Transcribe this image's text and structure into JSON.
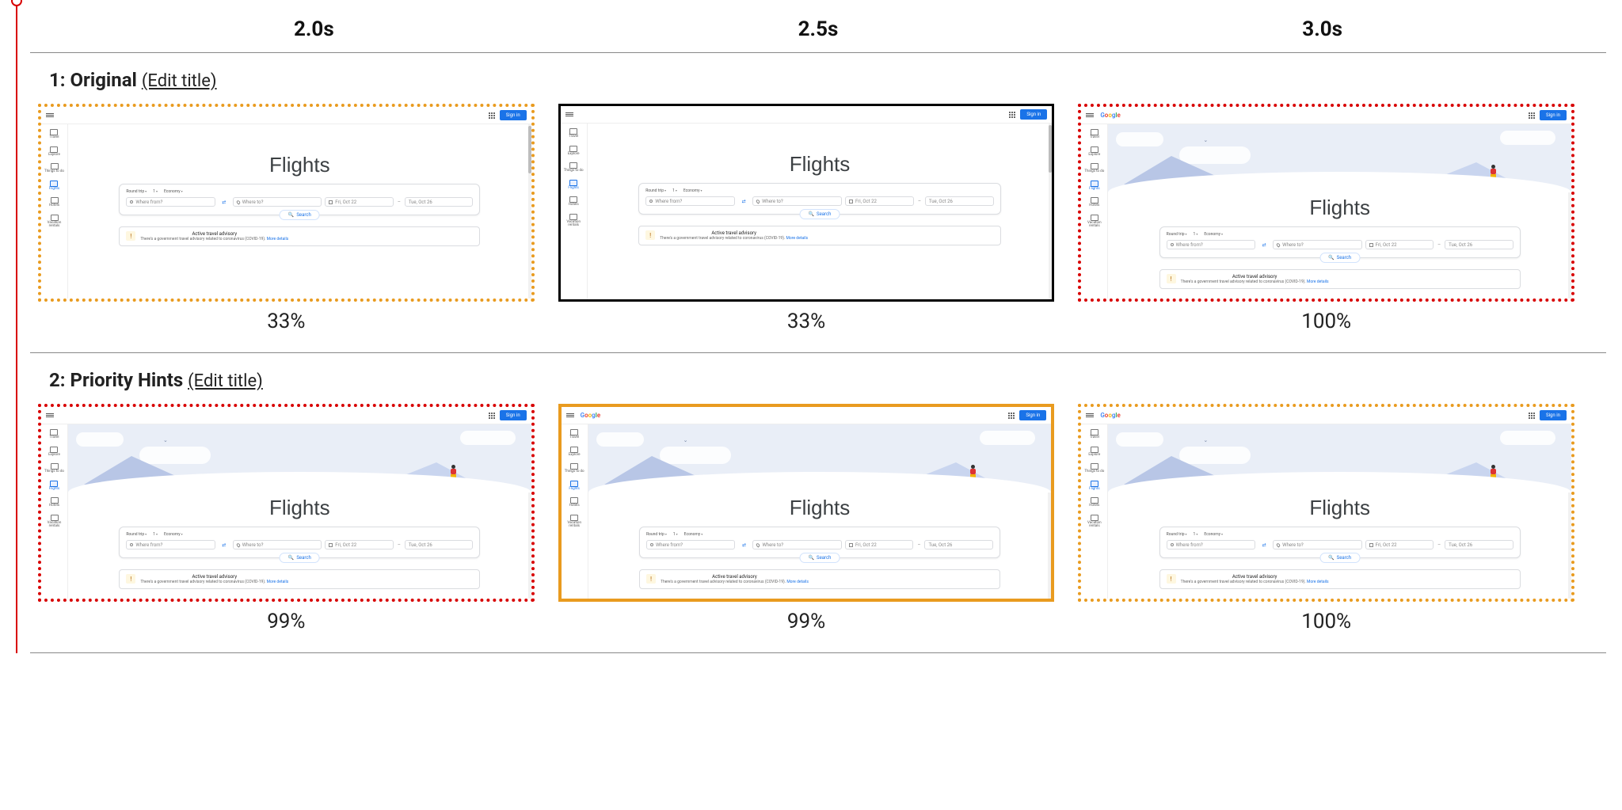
{
  "timeline": {
    "times": [
      "2.0s",
      "2.5s",
      "3.0s"
    ]
  },
  "edit_title_text": "(Edit title)",
  "rows": [
    {
      "index": "1",
      "title": "Original",
      "frames": [
        {
          "border": "border-dotted-orange",
          "percent": "33%",
          "has_hero": false,
          "has_logo": false,
          "bracket": true
        },
        {
          "border": "border-solid-black",
          "percent": "33%",
          "has_hero": false,
          "has_logo": false,
          "bracket": false
        },
        {
          "border": "border-dotted-red",
          "percent": "100%",
          "has_hero": true,
          "has_logo": true,
          "bracket": false
        }
      ]
    },
    {
      "index": "2",
      "title": "Priority Hints",
      "frames": [
        {
          "border": "border-dotted-red",
          "percent": "99%",
          "has_hero": true,
          "has_logo": false,
          "bracket": true
        },
        {
          "border": "border-solid-orange",
          "percent": "99%",
          "has_hero": true,
          "has_logo": true,
          "bracket": false
        },
        {
          "border": "border-dotted-orange",
          "percent": "100%",
          "has_hero": true,
          "has_logo": true,
          "bracket": false
        }
      ]
    }
  ],
  "mock": {
    "logo_letters": [
      "G",
      "o",
      "o",
      "g",
      "l",
      "e"
    ],
    "sign_in": "Sign in",
    "heading": "Flights",
    "sidebar": [
      {
        "label": "Travel"
      },
      {
        "label": "Explore"
      },
      {
        "label": "Things to do"
      },
      {
        "label": "Flights",
        "active": true
      },
      {
        "label": "Hotels"
      },
      {
        "label": "Vacation rentals"
      }
    ],
    "chips": {
      "trip": "Round trip",
      "pax": "1",
      "class": "Economy"
    },
    "fields": {
      "from_placeholder": "Where from?",
      "to_placeholder": "Where to?",
      "date1": "Fri, Oct 22",
      "date2": "Tue, Oct 26"
    },
    "search_btn": "Search",
    "advisory": {
      "title": "Active travel advisory",
      "body": "There's a government travel advisory related to coronavirus (COVID-19).",
      "more": "More details"
    }
  }
}
